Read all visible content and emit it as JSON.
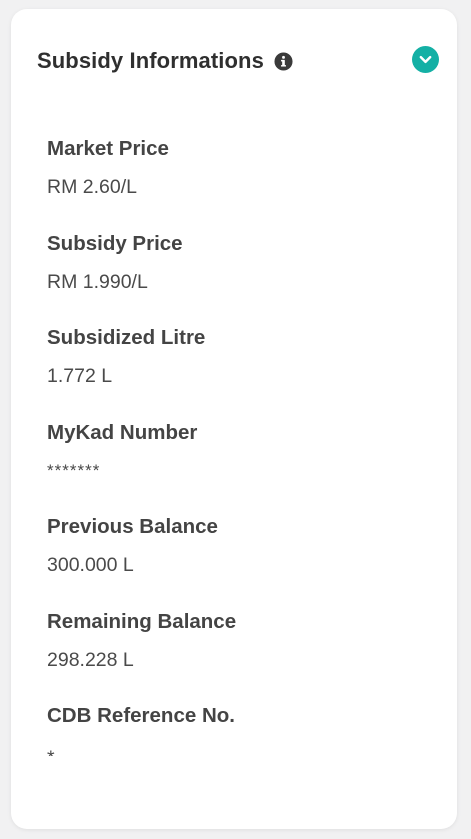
{
  "header": {
    "title": "Subsidy Informations"
  },
  "colors": {
    "accent": "#14b0a5",
    "card_background": "#ffffff",
    "page_background": "#f1f1f2"
  },
  "fields": [
    {
      "label": "Market Price",
      "value": "RM 2.60/L"
    },
    {
      "label": "Subsidy Price",
      "value": "RM 1.990/L"
    },
    {
      "label": "Subsidized Litre",
      "value": "1.772 L"
    },
    {
      "label": "MyKad Number",
      "value": "*******"
    },
    {
      "label": "Previous Balance",
      "value": "300.000 L"
    },
    {
      "label": "Remaining Balance",
      "value": "298.228 L"
    },
    {
      "label": "CDB Reference No.",
      "value": "*"
    }
  ],
  "icons": {
    "info": "info-icon",
    "toggle": "chevron-down-icon"
  }
}
